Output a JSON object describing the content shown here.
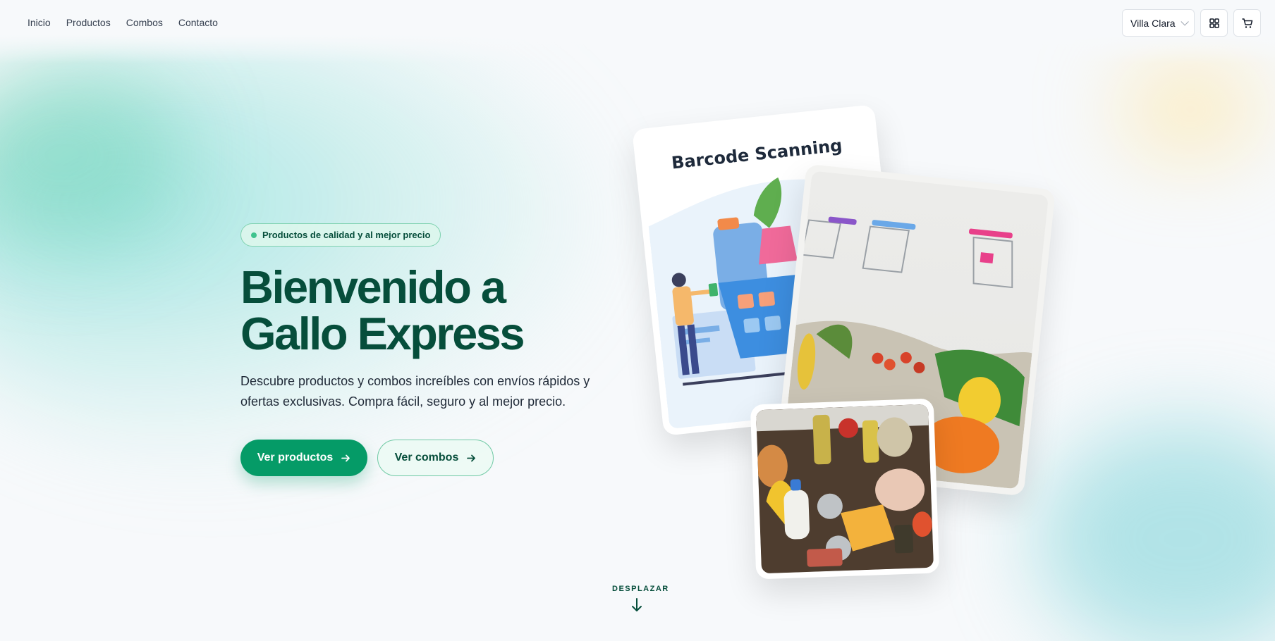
{
  "nav": {
    "links": [
      "Inicio",
      "Productos",
      "Combos",
      "Contacto"
    ],
    "region": "Villa Clara",
    "icons": [
      "grid-icon",
      "cart-icon"
    ]
  },
  "hero": {
    "badge": "Productos de calidad y al mejor precio",
    "title": "Bienvenido a Gallo Express",
    "subtitle": "Descubre productos y combos increíbles con envíos rápidos y ofertas exclusivas. Compra fácil, seguro y al mejor precio.",
    "primary_cta": "Ver productos",
    "secondary_cta": "Ver combos"
  },
  "images": {
    "card1_title": "Barcode Scanning"
  },
  "scroll_hint": "DESPLAZAR",
  "colors": {
    "brand_dark": "#064e3b",
    "brand": "#059b67",
    "accent_light": "#dcf6ec"
  }
}
